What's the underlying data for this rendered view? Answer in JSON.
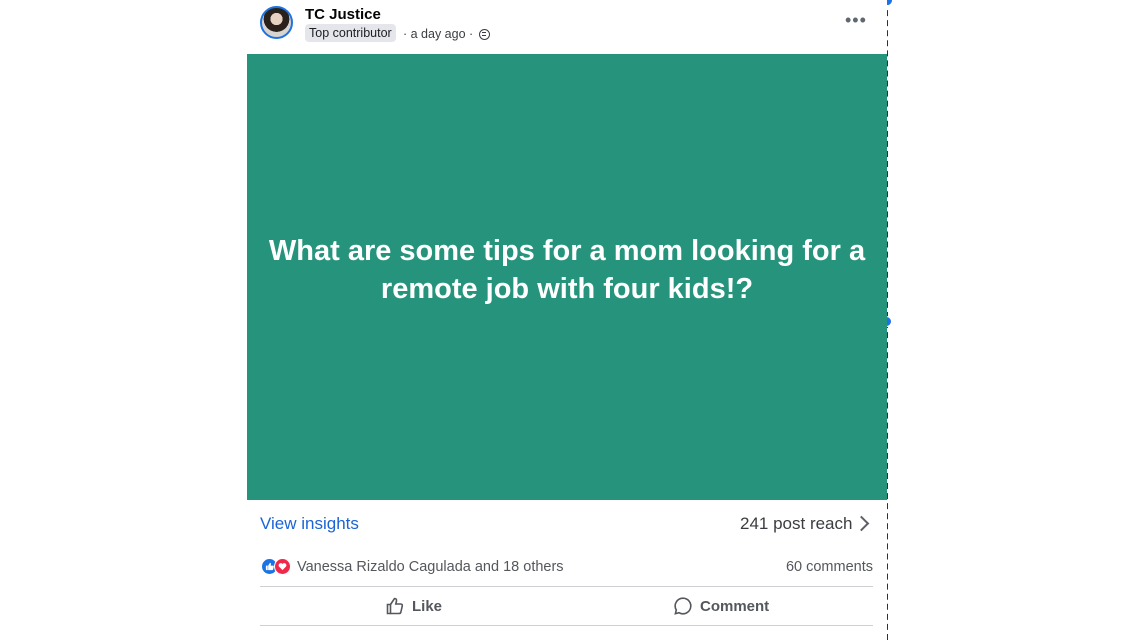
{
  "post": {
    "author": "TC Justice",
    "badge": "Top contributor",
    "time": "· a day ago ·",
    "more_label": "•••",
    "content": "What are some tips for a mom looking for a remote job with four kids!?",
    "card_color": "#26947d",
    "insights_label": "View insights",
    "reach_label": "241 post reach",
    "reactions_text": "Vanessa Rizaldo Cagulada and 18 others",
    "comments_count": "60 comments",
    "actions": {
      "like": "Like",
      "comment": "Comment"
    }
  },
  "icons": {
    "avatar": "profile-avatar",
    "audience": "globe-icon",
    "more": "more-options-icon",
    "chevron": "chevron-right-icon",
    "like_reaction": "thumbs-up-reaction-icon",
    "love_reaction": "heart-reaction-icon",
    "like_action": "thumbs-up-icon",
    "comment_action": "comment-bubble-icon"
  },
  "colors": {
    "accent": "#1b74e4",
    "link": "#1b64d6"
  }
}
